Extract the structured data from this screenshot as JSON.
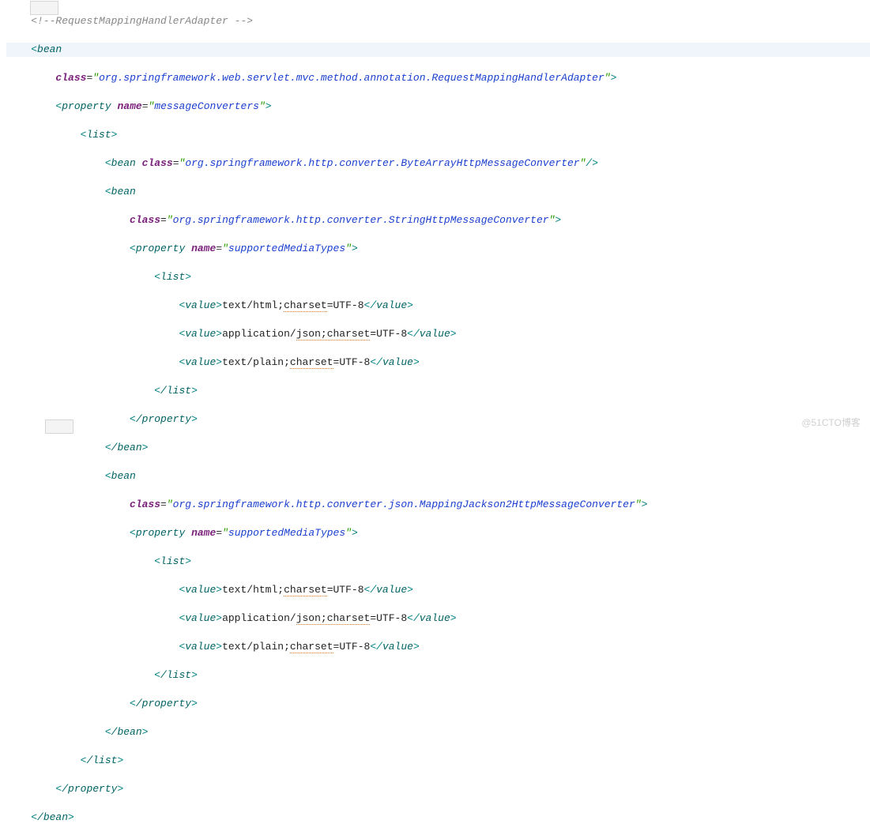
{
  "comment": "RequestMappingHandlerAdapter",
  "rootTag": "bean",
  "rootClassAttr": "class",
  "rootClass": "org.springframework.web.servlet.mvc.method.annotation.RequestMappingHandlerAdapter",
  "propTag": "property",
  "nameAttr": "name",
  "propName": "messageConverters",
  "listTag": "list",
  "valueTag": "value",
  "beanTag": "bean",
  "closePropTag": "/property",
  "closeListTag": "/list",
  "closeBeanTag": "/bean",
  "classAttr": "class",
  "byteArrayClass": "org.springframework.http.converter.ByteArrayHttpMessageConverter",
  "stringClass": "org.springframework.http.converter.StringHttpMessageConverter",
  "jacksonClass": "org.springframework.http.converter.json.MappingJackson2HttpMessageConverter",
  "supportedProp": "supportedMediaTypes",
  "v1a": "text/html;",
  "v1b": "charset",
  "v1c": "=UTF-8",
  "v2a": "application/",
  "v2b": "json;charset",
  "v2c": "=UTF-8",
  "v3a": "text/plain;",
  "v3b": "charset",
  "v3c": "=UTF-8",
  "watermark": "@51CTO博客"
}
